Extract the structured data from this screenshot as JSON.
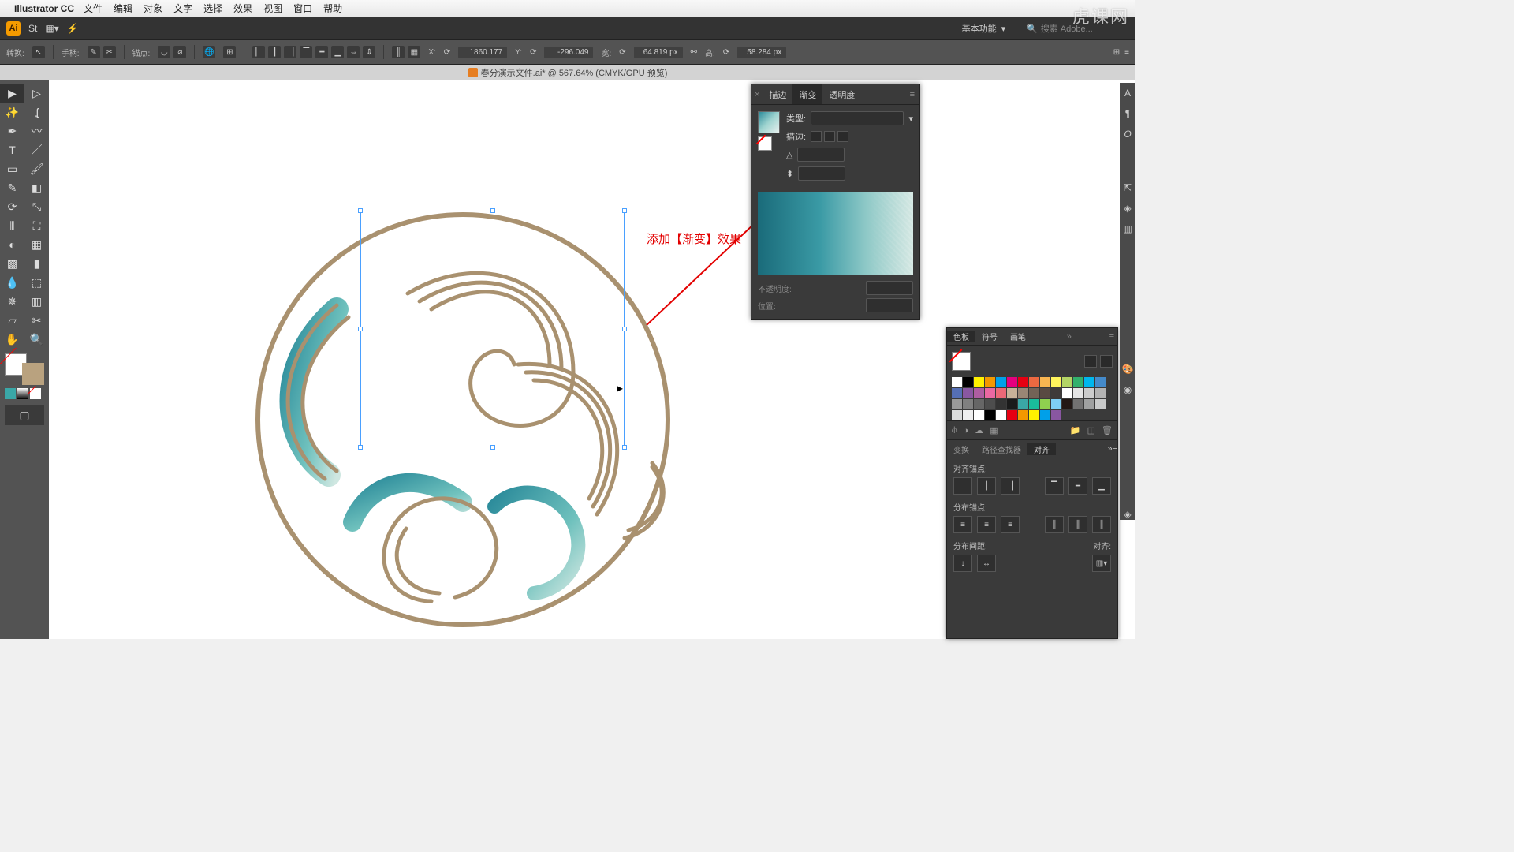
{
  "menubar": {
    "app": "Illustrator CC",
    "items": [
      "文件",
      "编辑",
      "对象",
      "文字",
      "选择",
      "效果",
      "视图",
      "窗口",
      "帮助"
    ]
  },
  "appbar": {
    "basic_label": "基本功能",
    "search_placeholder": "搜索 Adobe..."
  },
  "ctrlbar": {
    "transform_label": "转换:",
    "handle_label": "手柄:",
    "anchor_label": "锚点:",
    "x_label": "X:",
    "x_value": "1860.177",
    "y_label": "Y:",
    "y_value": "-296.049",
    "w_label": "宽:",
    "w_value": "64.819 px",
    "h_label": "高:",
    "h_value": "58.284 px"
  },
  "doc": {
    "title": "春分演示文件.ai* @ 567.64% (CMYK/GPU 预览)"
  },
  "gradient_panel": {
    "tabs": [
      "描边",
      "渐变",
      "透明度"
    ],
    "active_tab": 1,
    "type_label": "类型:",
    "stroke_label": "描边:",
    "opacity_label": "不透明度:",
    "position_label": "位置:"
  },
  "swatch_panel": {
    "tabs": [
      "色板",
      "符号",
      "画笔"
    ],
    "active_tab": 0
  },
  "swatch_colors": [
    "#ffffff",
    "#000000",
    "#fff100",
    "#f39800",
    "#00a0e9",
    "#e4007f",
    "#e60012",
    "#ec6941",
    "#f8b551",
    "#fff45c",
    "#b3d465",
    "#32b16c",
    "#00b7ee",
    "#448aca",
    "#556fb5",
    "#8957a1",
    "#ae5da1",
    "#ea68a2",
    "#eb6877",
    "#c7b299",
    "#998675",
    "#736357",
    "#594a42",
    "#3e3a39",
    "#fff",
    "#e5e5e5",
    "#cccccc",
    "#b3b3b3",
    "#999999",
    "#808080",
    "#666666",
    "#4d4d4d",
    "#333333",
    "#1a1a1a",
    "#3aa7a7",
    "#1abc9c",
    "#8fd14f",
    "#7ecef4",
    "#231815",
    "#727171",
    "#9fa0a0",
    "#c9caca",
    "#dcdddd",
    "#efefef",
    "#ffffff",
    "#000000",
    "#ffffff",
    "#e60012",
    "#f39800",
    "#fff100",
    "#00a0e9",
    "#8957a1"
  ],
  "align_panel": {
    "tabs": [
      "变换",
      "路径查找器",
      "对齐"
    ],
    "active_tab": 2,
    "sec1": "对齐锚点:",
    "sec2": "分布锚点:",
    "sec3": "分布间距:",
    "sec3_right": "对齐:"
  },
  "annotation": "添加【渐变】效果",
  "watermark": "虎课网"
}
